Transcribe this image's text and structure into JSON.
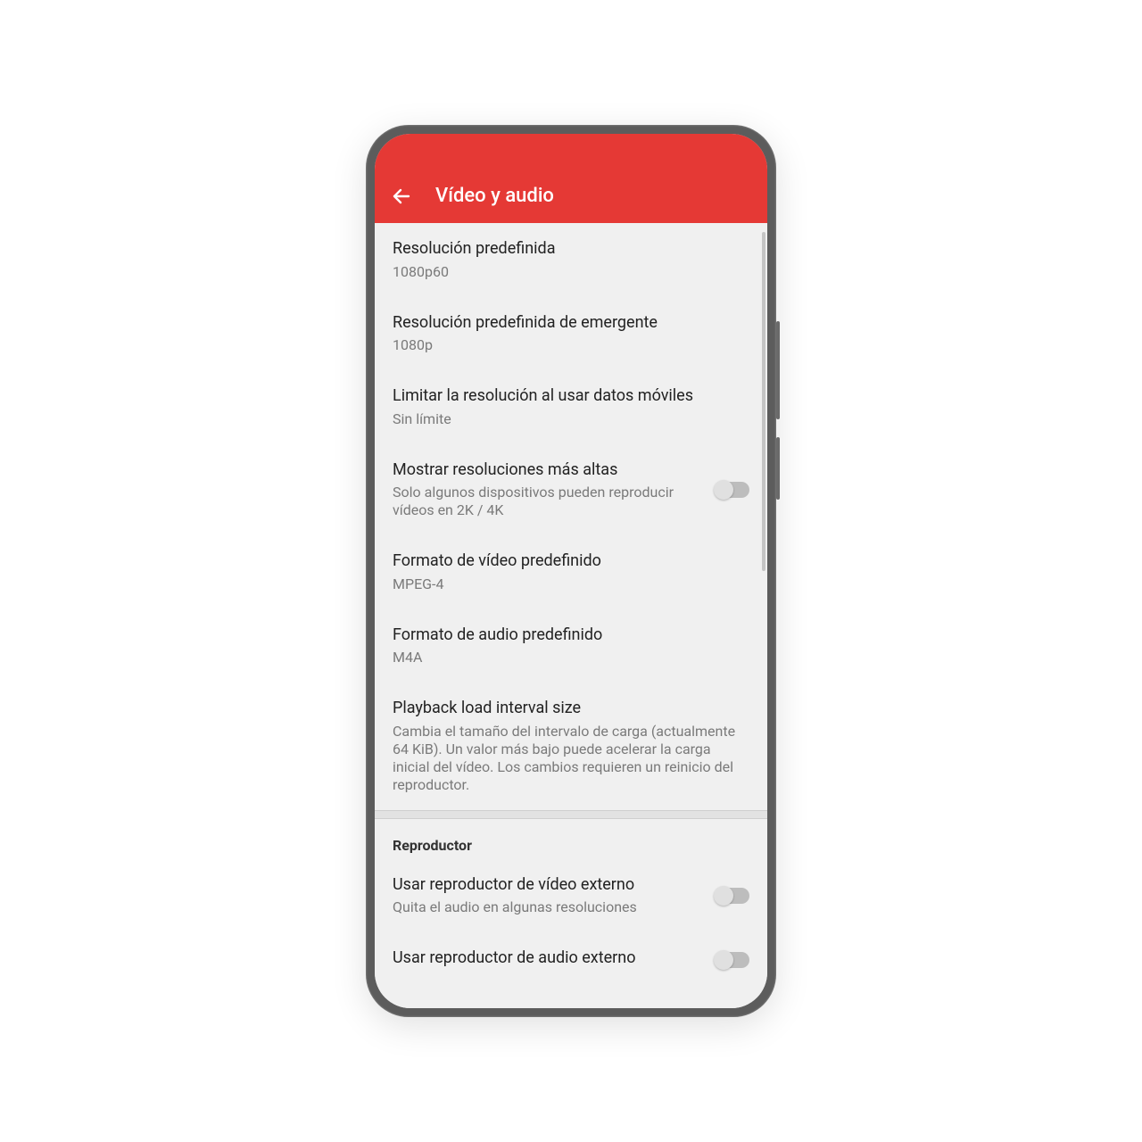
{
  "header": {
    "title": "Vídeo y audio"
  },
  "settings": [
    {
      "id": "default-resolution",
      "title": "Resolución predefinida",
      "sub": "1080p60",
      "toggle": false
    },
    {
      "id": "popup-resolution",
      "title": "Resolución predefinida de emergente",
      "sub": "1080p",
      "toggle": false
    },
    {
      "id": "limit-mobile",
      "title": "Limitar la resolución al usar datos móviles",
      "sub": "Sin límite",
      "toggle": false
    },
    {
      "id": "show-higher-res",
      "title": "Mostrar resoluciones más altas",
      "sub": "Solo algunos dispositivos pueden reproducir vídeos en 2K / 4K",
      "toggle": true
    },
    {
      "id": "video-format",
      "title": "Formato de vídeo predefinido",
      "sub": "MPEG-4",
      "toggle": false
    },
    {
      "id": "audio-format",
      "title": "Formato de audio predefinido",
      "sub": "M4A",
      "toggle": false
    },
    {
      "id": "load-interval",
      "title": "Playback load interval size",
      "sub": "Cambia el tamaño del intervalo de carga (actualmente 64 KiB). Un valor más bajo puede acelerar la carga inicial del vídeo. Los cambios requieren un reinicio del reproductor.",
      "toggle": false
    }
  ],
  "section2": {
    "header": "Reproductor",
    "items": [
      {
        "id": "external-video",
        "title": "Usar reproductor de vídeo externo",
        "sub": "Quita el audio en algunas resoluciones",
        "toggle": true
      },
      {
        "id": "external-audio",
        "title": "Usar reproductor de audio externo",
        "sub": "",
        "toggle": true
      }
    ]
  }
}
